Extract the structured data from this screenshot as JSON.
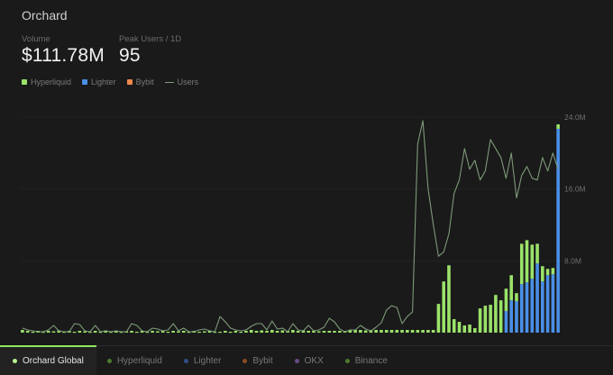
{
  "app": {
    "title": "Orchard"
  },
  "stats": {
    "volume_label": "Volume",
    "volume_value": "$111.78M",
    "peak_label": "Peak Users / 1D",
    "peak_value": "95"
  },
  "legend": [
    {
      "label": "Hyperliquid",
      "color": "#9be26a",
      "kind": "square"
    },
    {
      "label": "Lighter",
      "color": "#4a8fe7",
      "kind": "square"
    },
    {
      "label": "Bybit",
      "color": "#f08a4b",
      "kind": "square"
    },
    {
      "label": "Users",
      "color": "#7d9a78",
      "kind": "line"
    }
  ],
  "tabs": [
    {
      "label": "Orchard Global",
      "color": "#b9f28f",
      "active": true
    },
    {
      "label": "Hyperliquid",
      "color": "#4f7a2e",
      "active": false
    },
    {
      "label": "Lighter",
      "color": "#2f4f88",
      "active": false
    },
    {
      "label": "Bybit",
      "color": "#8a4a22",
      "active": false
    },
    {
      "label": "OKX",
      "color": "#6b4a8a",
      "active": false
    },
    {
      "label": "Binance",
      "color": "#4f7a2e",
      "active": false
    }
  ],
  "chart_data": {
    "type": "bar",
    "stacked": true,
    "y_axis_labels": [
      "24.0M",
      "16.0M",
      "8.0M"
    ],
    "y_axis_values": [
      24,
      16,
      8
    ],
    "ylim": [
      0,
      25
    ],
    "units": "M",
    "series": [
      {
        "name": "Hyperliquid",
        "color": "#9be26a",
        "values": [
          0.3,
          0.2,
          0.1,
          0.2,
          0.1,
          0.2,
          0.15,
          0.25,
          0.1,
          0.2,
          0.1,
          0.2,
          0.15,
          0.1,
          0.2,
          0.1,
          0.25,
          0.1,
          0.2,
          0.1,
          0.15,
          0.2,
          0.1,
          0.2,
          0.1,
          0.2,
          0.15,
          0.2,
          0.1,
          0.2,
          0.15,
          0.2,
          0.1,
          0.2,
          0.1,
          0.15,
          0.2,
          0.1,
          0.1,
          0.2,
          0.1,
          0.2,
          0.1,
          0.2,
          0.3,
          0.2,
          0.25,
          0.2,
          0.3,
          0.2,
          0.25,
          0.2,
          0.3,
          0.2,
          0.25,
          0.2,
          0.2,
          0.15,
          0.2,
          0.2,
          0.2,
          0.2,
          0.2,
          0.3,
          0.3,
          0.3,
          0.25,
          0.3,
          0.3,
          0.3,
          0.3,
          0.3,
          0.3,
          0.3,
          0.3,
          0.3,
          0.3,
          0.3,
          0.3,
          0.3,
          3.2,
          5.7,
          7.5,
          1.5,
          1.2,
          0.8,
          0.9,
          0.5,
          2.7,
          3.0,
          3.1,
          4.2,
          3.6,
          2.5,
          2.8,
          0.9,
          4.5,
          4.7,
          3.8,
          2.2,
          1.7,
          0.7,
          0.7,
          0.5
        ]
      },
      {
        "name": "Lighter",
        "color": "#4a8fe7",
        "values": [
          0,
          0,
          0,
          0,
          0,
          0,
          0,
          0,
          0,
          0,
          0,
          0,
          0,
          0,
          0,
          0,
          0,
          0,
          0,
          0,
          0,
          0,
          0,
          0,
          0,
          0,
          0,
          0,
          0,
          0,
          0,
          0,
          0,
          0,
          0,
          0,
          0,
          0,
          0,
          0,
          0,
          0,
          0,
          0,
          0,
          0,
          0,
          0,
          0,
          0,
          0,
          0,
          0,
          0,
          0,
          0,
          0,
          0,
          0,
          0,
          0,
          0,
          0,
          0,
          0,
          0,
          0,
          0,
          0,
          0,
          0,
          0,
          0,
          0,
          0,
          0,
          0,
          0,
          0,
          0,
          0,
          0,
          0,
          0,
          0,
          0,
          0,
          0,
          0,
          0,
          0,
          0,
          0,
          2.4,
          3.6,
          3.5,
          5.4,
          5.6,
          6.0,
          7.7,
          5.7,
          6.4,
          6.5,
          22.7
        ]
      },
      {
        "name": "Users",
        "color": "#7d9a78",
        "values": [
          0.5,
          0.3,
          0.2,
          0.1,
          0.1,
          0.3,
          0.8,
          0.2,
          0.1,
          0.1,
          1.0,
          0.9,
          0.2,
          0.1,
          0.8,
          0.1,
          0.2,
          0.1,
          0.2,
          0.1,
          0.1,
          1.0,
          0.8,
          0.2,
          0.1,
          0.5,
          0.4,
          0.2,
          0.3,
          1.0,
          0.2,
          0.5,
          0.1,
          0.1,
          0.3,
          0.4,
          0.2,
          0.1,
          1.8,
          1.2,
          0.5,
          0.3,
          0.2,
          0.3,
          0.7,
          1.0,
          1.0,
          0.3,
          1.3,
          0.4,
          0.5,
          0.1,
          1.0,
          0.3,
          0.2,
          0.8,
          0.2,
          0.3,
          0.6,
          1.6,
          1.2,
          0.4,
          0.1,
          0.3,
          0.3,
          0.8,
          0.4,
          0.2,
          0.6,
          1.1,
          2.5,
          3.0,
          2.8,
          1.0,
          1.8,
          2.3,
          21.0,
          23.6,
          16.0,
          12.0,
          8.5,
          9.0,
          11.0,
          15.5,
          17.0,
          20.5,
          18.2,
          19.2,
          17.0,
          18.0,
          21.5,
          20.5,
          19.5,
          17.2,
          20.0,
          15.0,
          17.5,
          18.5,
          17.2,
          17.0,
          19.5,
          18.0,
          20.0,
          18.2
        ]
      }
    ]
  }
}
